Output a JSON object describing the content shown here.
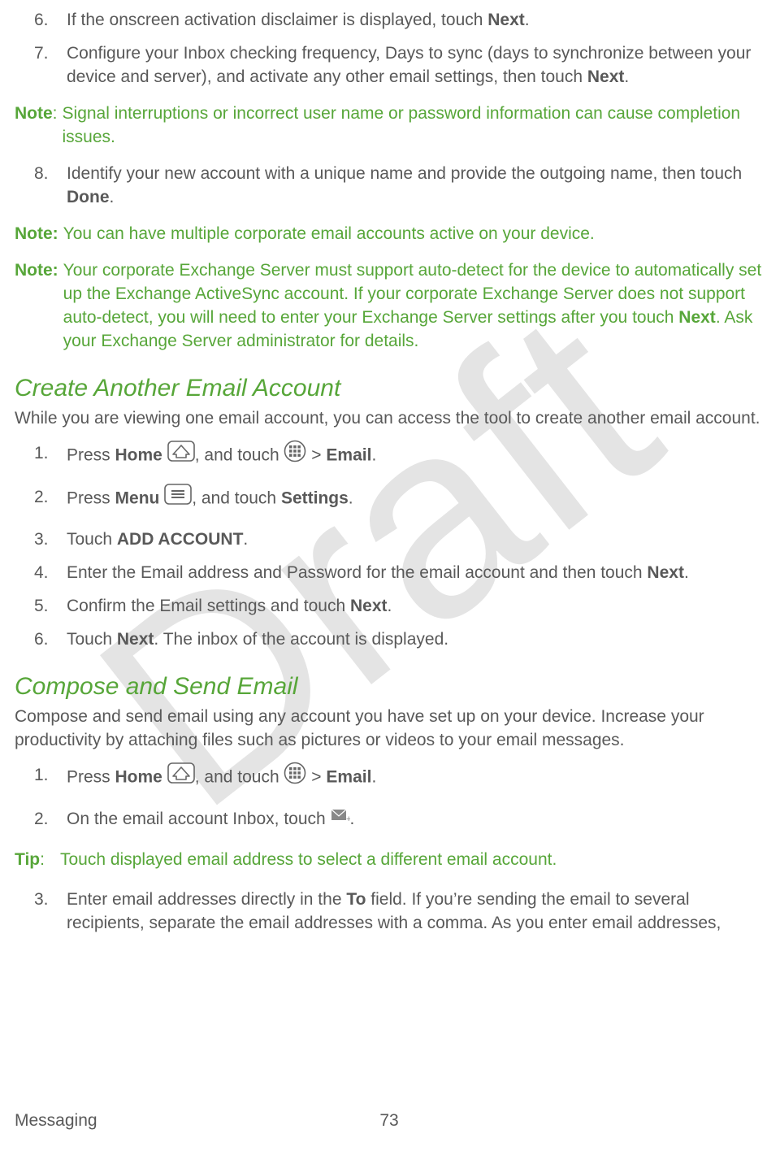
{
  "watermark_text": "Draft",
  "section1": {
    "items": [
      {
        "num": "6.",
        "pre": "If the onscreen activation disclaimer is displayed, touch ",
        "bold": "Next",
        "post": "."
      },
      {
        "num": "7.",
        "pre": "Configure your Inbox checking frequency, Days to sync (days to synchronize between your device and server), and activate any other email settings, then touch ",
        "bold": "Next",
        "post": "."
      }
    ]
  },
  "note1": {
    "label": "Note",
    "colon": ":",
    "text": "Signal interruptions or incorrect user name or password information can cause completion issues."
  },
  "section2": {
    "items": [
      {
        "num": "8.",
        "pre": "Identify your new account with a unique name and provide the outgoing name, then touch ",
        "bold": "Done",
        "post": "."
      }
    ]
  },
  "note2": {
    "label": "Note:",
    "text": "You can have multiple corporate email accounts active on your device."
  },
  "note3": {
    "label": "Note:",
    "text_a": "Your corporate Exchange Server must support auto-detect for the device to automatically set up the Exchange ActiveSync account. If your corporate Exchange Server does not support auto-detect, you will need to enter your Exchange Server settings after you touch ",
    "bold": "Next",
    "text_b": ". Ask your Exchange Server administrator for details."
  },
  "h_create": "Create Another Email Account",
  "create_intro": "While you are viewing one email account, you can access the tool to create another email account.",
  "create_steps": {
    "s1": {
      "num": "1.",
      "a": "Press ",
      "b1": "Home",
      "b": " ",
      "c": ", and touch ",
      "d": " > ",
      "b2": "Email",
      "e": "."
    },
    "s2": {
      "num": "2.",
      "a": "Press ",
      "b1": "Menu",
      "b": " ",
      "c": ", and touch ",
      "b2": "Settings",
      "d": "."
    },
    "s3": {
      "num": "3.",
      "a": "Touch ",
      "b1": "ADD ACCOUNT",
      "b": "."
    },
    "s4": {
      "num": "4.",
      "a": "Enter the Email address and Password for the email account and then touch ",
      "b1": "Next",
      "b": "."
    },
    "s5": {
      "num": "5.",
      "a": "Confirm the Email settings and touch ",
      "b1": "Next",
      "b": "."
    },
    "s6": {
      "num": "6.",
      "a": "Touch ",
      "b1": "Next",
      "b": ". The inbox of the account is displayed."
    }
  },
  "h_compose": "Compose and Send Email",
  "compose_intro": "Compose and send email using any account you have set up on your device. Increase your productivity by attaching files such as pictures or videos to your email messages.",
  "compose_steps": {
    "s1": {
      "num": "1.",
      "a": "Press ",
      "b1": "Home",
      "b": " ",
      "c": ", and touch ",
      "d": " > ",
      "b2": "Email",
      "e": "."
    },
    "s2": {
      "num": "2.",
      "a": "On the email account Inbox, touch ",
      "b": "."
    }
  },
  "tip": {
    "label": "Tip",
    "colon": ":",
    "text": "Touch displayed email address to select a different email account."
  },
  "compose_steps2": {
    "s3": {
      "num": "3.",
      "a": "Enter email addresses directly in the ",
      "b1": "To",
      "b": " field. If you’re sending the email to several recipients, separate the email addresses with a comma. As you enter email addresses,"
    }
  },
  "footer": {
    "section": "Messaging",
    "page": "73"
  }
}
